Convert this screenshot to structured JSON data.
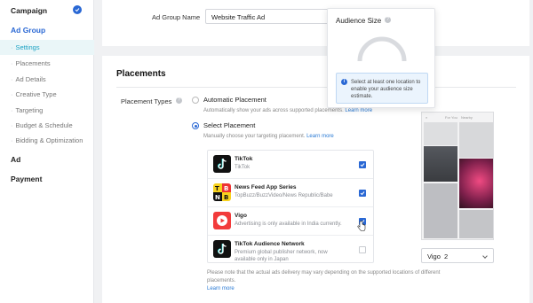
{
  "sidebar": {
    "campaign": "Campaign",
    "ad_group": "Ad Group",
    "items": [
      {
        "label": "Settings"
      },
      {
        "label": "Placements"
      },
      {
        "label": "Ad Details"
      },
      {
        "label": "Creative Type"
      },
      {
        "label": "Targeting"
      },
      {
        "label": "Budget & Schedule"
      },
      {
        "label": "Bidding & Optimization"
      }
    ],
    "ad": "Ad",
    "payment": "Payment"
  },
  "ad_group_name": {
    "label": "Ad Group Name",
    "value": "Website Traffic Ad"
  },
  "audience_size": {
    "title": "Audience Size",
    "info": "Select at least one location to enable your audience size estimate."
  },
  "placements": {
    "title": "Placements",
    "types_label": "Placement Types",
    "automatic": {
      "label": "Automatic Placement",
      "hint": "Automatically show your ads across supported placements.",
      "link": "Learn more"
    },
    "select": {
      "label": "Select Placement",
      "hint": "Manually choose your targeting placement.",
      "link": "Learn more"
    },
    "list": [
      {
        "name": "TikTok",
        "desc": "TikTok",
        "checked": true,
        "logo": "tiktok-logo"
      },
      {
        "name": "News Feed App Series",
        "desc": "TopBuzz/BuzzVideo/News Republic/Babe",
        "checked": true,
        "logo": "news-feed-logo"
      },
      {
        "name": "Vigo",
        "desc": "Advertising is only available in India currently.",
        "checked": true,
        "logo": "vigo-logo"
      },
      {
        "name": "TikTok Audience Network",
        "desc": "Premium global publisher network, now",
        "desc2": "available only in Japan",
        "checked": false,
        "logo": "tiktok-logo"
      }
    ],
    "note": "Please note that the actual ads delivery may vary depending on the supported locations of different placements.",
    "note_link": "Learn more"
  },
  "preview": {
    "tabs": [
      "For You",
      "Nearby"
    ],
    "select_value": "Vigo  2"
  },
  "colors": {
    "accent": "#2a68d4",
    "active_nav": "#1ba2c3",
    "link": "#2a7ad4"
  }
}
